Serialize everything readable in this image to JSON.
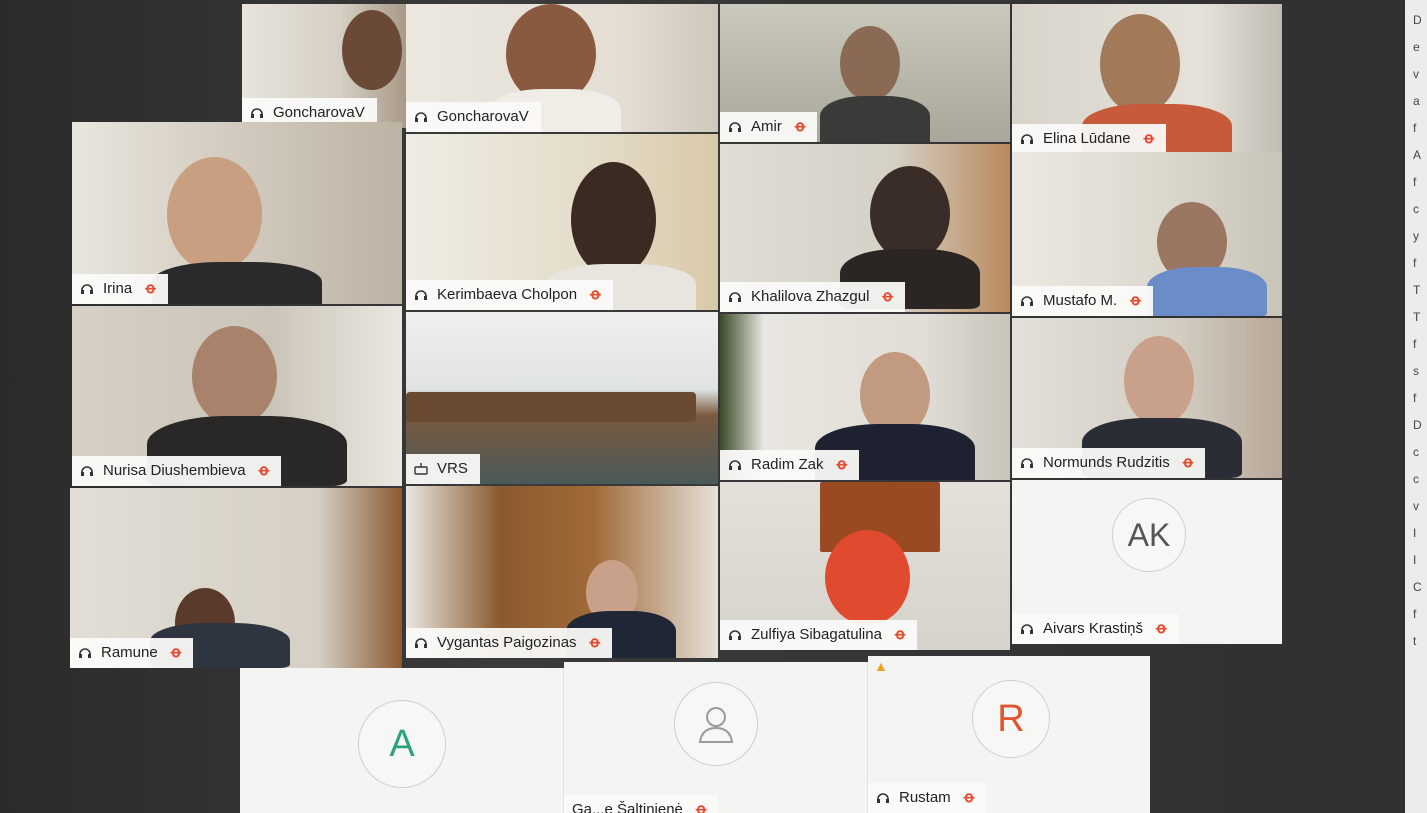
{
  "side_panel": {
    "fragments": [
      "D",
      "e",
      "v",
      "a",
      "f",
      "A",
      "f",
      "c",
      "y",
      "f",
      "T",
      "T",
      "f",
      "s",
      "f",
      "D",
      "c",
      "c",
      "v",
      "I",
      "I",
      "C",
      "f",
      "t"
    ]
  },
  "tiles": [
    {
      "name": "GoncharovaV",
      "muted": false
    },
    {
      "name": "GoncharovaV",
      "muted": false,
      "active": true
    },
    {
      "name": "Amir",
      "muted": true
    },
    {
      "name": "Elina Lūdane",
      "muted": true
    },
    {
      "name": "Irina",
      "muted": true
    },
    {
      "name": "Kerimbaeva Cholpon",
      "muted": true
    },
    {
      "name": "Khalilova Zhazgul",
      "muted": true
    },
    {
      "name": "Mustafo M.",
      "muted": true
    },
    {
      "name": "Nurisa Diushembieva",
      "muted": true
    },
    {
      "name": "VRS",
      "muted": false,
      "device": "room-system"
    },
    {
      "name": "Radim Zak",
      "muted": true
    },
    {
      "name": "Normunds Rudzitis",
      "muted": true
    },
    {
      "name": "Ramune",
      "muted": true
    },
    {
      "name": "Vygantas Paigozinas",
      "muted": true
    },
    {
      "name": "Zulfiya Sibagatulina",
      "muted": true
    },
    {
      "name": "Aivars Krastiņš",
      "muted": true,
      "avatar": "AK"
    }
  ],
  "bottom_row": [
    {
      "avatar": "A",
      "avatar_color": "#2aa37a"
    },
    {
      "avatar": "person-icon",
      "avatar_color": "#9a9a9a"
    },
    {
      "avatar": "R",
      "avatar_color": "#e0542e",
      "name": "Rustam",
      "muted": true,
      "warning": true
    }
  ],
  "partial_name": "Ga...e Šaltinienė",
  "mic_muted_glyph": "ꝋ",
  "colors": {
    "active_border": "#3fbad0",
    "muted_icon": "#e64a2e"
  }
}
